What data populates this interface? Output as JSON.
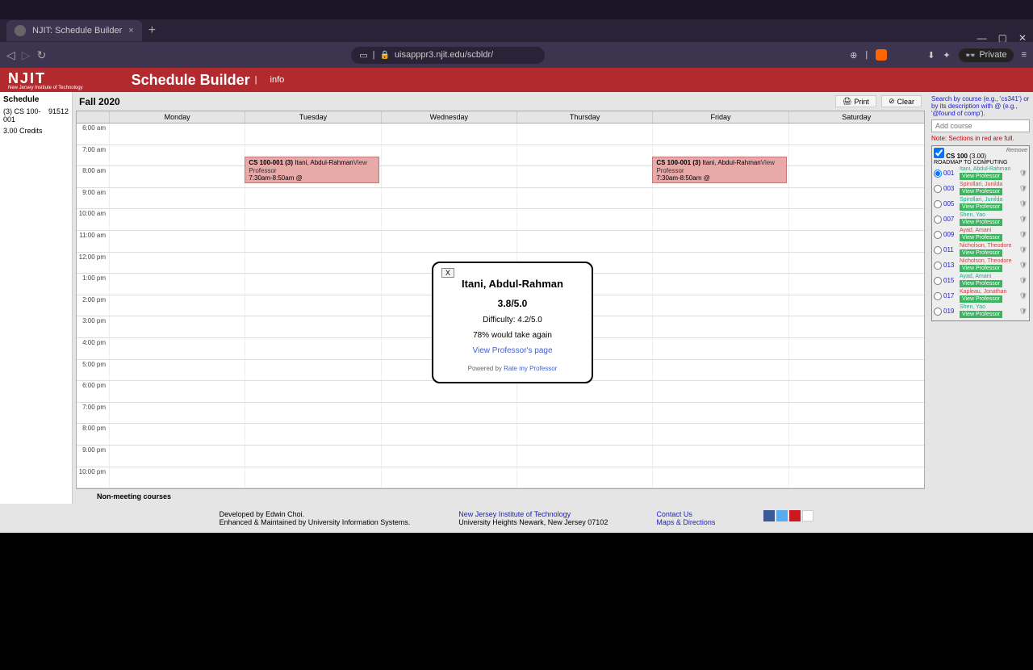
{
  "browser": {
    "tab_title": "NJIT: Schedule Builder",
    "url": "uisapppr3.njit.edu/scbldr/",
    "private_label": "Private"
  },
  "header": {
    "logo": "NJIT",
    "logo_sub": "New Jersey Institute of Technology",
    "title": "Schedule Builder",
    "info": "info"
  },
  "left": {
    "title": "Schedule",
    "course_row": "(3) CS 100-001",
    "course_crn": "91512",
    "credits": "3.00 Credits"
  },
  "calendar": {
    "semester": "Fall 2020",
    "print": "Print",
    "clear": "Clear",
    "days": [
      "Monday",
      "Tuesday",
      "Wednesday",
      "Thursday",
      "Friday",
      "Saturday"
    ],
    "times": [
      "6:00 am",
      "7:00 am",
      "8:00 am",
      "9:00 am",
      "10:00 am",
      "11:00 am",
      "12:00 pm",
      "1:00 pm",
      "2:00 pm",
      "3:00 pm",
      "4:00 pm",
      "5:00 pm",
      "6:00 pm",
      "7:00 pm",
      "8:00 pm",
      "9:00 pm",
      "10:00 pm"
    ],
    "nonmeeting": "Non-meeting courses"
  },
  "event": {
    "title": "CS 100-001 (3)",
    "instructor": "Itani, Abdul-Rahman",
    "view": "View Professor",
    "time": "7:30am-8:50am @",
    "desc": "ROADMAP TO COMPUTING"
  },
  "right": {
    "help": "Search by course (e.g., 'cs341') or by its description with @ (e.g., '@found of comp').",
    "placeholder": "Add course",
    "note": "Note: Sections in red are full.",
    "course_code": "CS 100",
    "course_credits": "(3.00)",
    "remove": "Remove",
    "course_title": "ROADMAP TO COMPUTING",
    "sections": [
      {
        "num": "001",
        "prof": "Itani, Abdul-Rahman",
        "full": false,
        "selected": true
      },
      {
        "num": "003",
        "prof": "Spirollari, Junilda",
        "full": true,
        "selected": false
      },
      {
        "num": "005",
        "prof": "Spirollari, Junilda",
        "full": false,
        "selected": false
      },
      {
        "num": "007",
        "prof": "Shen, Yao",
        "full": false,
        "selected": false
      },
      {
        "num": "009",
        "prof": "Ayad, Amani",
        "full": true,
        "selected": false
      },
      {
        "num": "011",
        "prof": "Nicholson, Theodore",
        "full": true,
        "selected": false
      },
      {
        "num": "013",
        "prof": "Nicholson, Theodore",
        "full": true,
        "selected": false
      },
      {
        "num": "015",
        "prof": "Ayad, Amani",
        "full": false,
        "selected": false
      },
      {
        "num": "017",
        "prof": "Kapleau, Jonathan",
        "full": true,
        "selected": false
      },
      {
        "num": "019",
        "prof": "Shen, Yao",
        "full": false,
        "selected": false
      }
    ],
    "view_btn": "View Professor"
  },
  "modal": {
    "close": "X",
    "name": "Itani, Abdul-Rahman",
    "rating": "3.8/5.0",
    "difficulty": "Difficulty: 4.2/5.0",
    "again": "78% would take again",
    "link": "View Professor's page",
    "powered_pre": "Powered by ",
    "powered_link": "Rate my Professor"
  },
  "footer": {
    "dev": "Developed by Edwin Choi.",
    "enh": "Enhanced & Maintained by University Information Systems.",
    "njit": "New Jersey Institute of Technology",
    "addr": "University Heights Newark, New Jersey 07102",
    "contact": "Contact Us",
    "maps": "Maps & Directions"
  }
}
